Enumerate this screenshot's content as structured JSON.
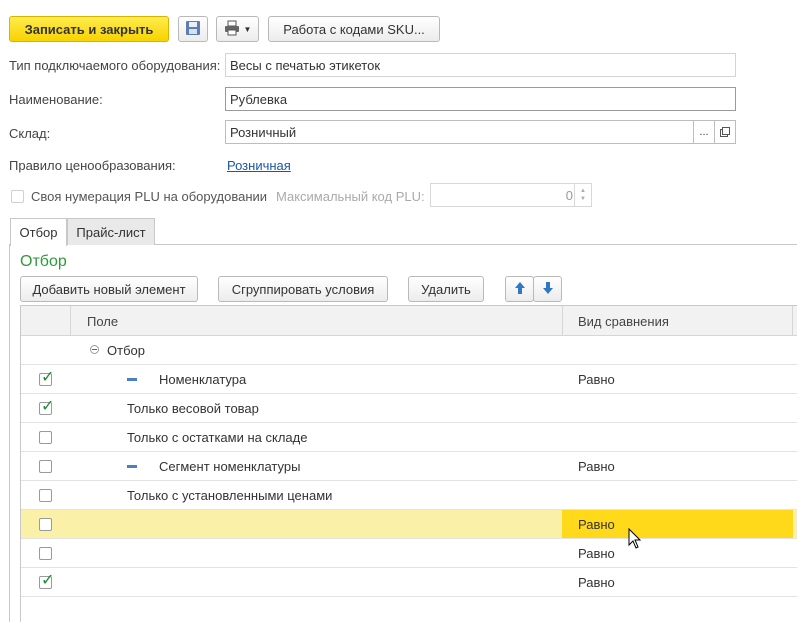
{
  "toolbar": {
    "save_close_label": "Записать и закрыть",
    "save_icon": "floppy-disk-icon",
    "print_icon": "printer-icon",
    "sku_label": "Работа с кодами SKU..."
  },
  "form": {
    "equipment_type_label": "Тип подключаемого оборудования:",
    "equipment_type_value": "Весы с печатью этикеток",
    "name_label": "Наименование:",
    "name_value": "Рублевка",
    "warehouse_label": "Склад:",
    "warehouse_value": "Розничный",
    "warehouse_select_label": "...",
    "pricing_rule_label": "Правило ценообразования:",
    "pricing_rule_value": "Розничная",
    "own_plu_label": "Своя нумерация PLU на оборудовании",
    "max_plu_label": "Максимальный код PLU:",
    "max_plu_value": "0"
  },
  "tabs": [
    {
      "label": "Отбор",
      "active": true
    },
    {
      "label": "Прайс-лист",
      "active": false
    }
  ],
  "filter": {
    "section_title": "Отбор",
    "add_label": "Добавить новый элемент",
    "group_label": "Сгруппировать условия",
    "delete_label": "Удалить",
    "up_icon": "arrow-up-icon",
    "down_icon": "arrow-down-icon"
  },
  "grid": {
    "col_field": "Поле",
    "col_compare": "Вид сравнения",
    "rows": [
      {
        "checkbox": false,
        "checked": false,
        "field": "Отбор",
        "compare": "",
        "group": true
      },
      {
        "checkbox": true,
        "checked": true,
        "field": "Номенклатура",
        "compare": "Равно",
        "minus": true
      },
      {
        "checkbox": true,
        "checked": true,
        "field": "Только весовой товар",
        "compare": ""
      },
      {
        "checkbox": true,
        "checked": false,
        "field": "Только с остатками на складе",
        "compare": ""
      },
      {
        "checkbox": true,
        "checked": false,
        "field": "Сегмент номенклатуры",
        "compare": "Равно",
        "minus": true
      },
      {
        "checkbox": true,
        "checked": false,
        "field": "Только с установленными ценами",
        "compare": ""
      },
      {
        "checkbox": true,
        "checked": false,
        "field": "",
        "compare": "Равно",
        "selected": true
      },
      {
        "checkbox": true,
        "checked": false,
        "field": "",
        "compare": "Равно"
      },
      {
        "checkbox": true,
        "checked": true,
        "field": "",
        "compare": "Равно"
      }
    ]
  },
  "colors": {
    "accent_yellow": "#f7d300",
    "selected_row": "#fbf0a8",
    "selected_cell": "#ffd91a",
    "section_title": "#2e9a3a",
    "link": "#1a57a6"
  }
}
